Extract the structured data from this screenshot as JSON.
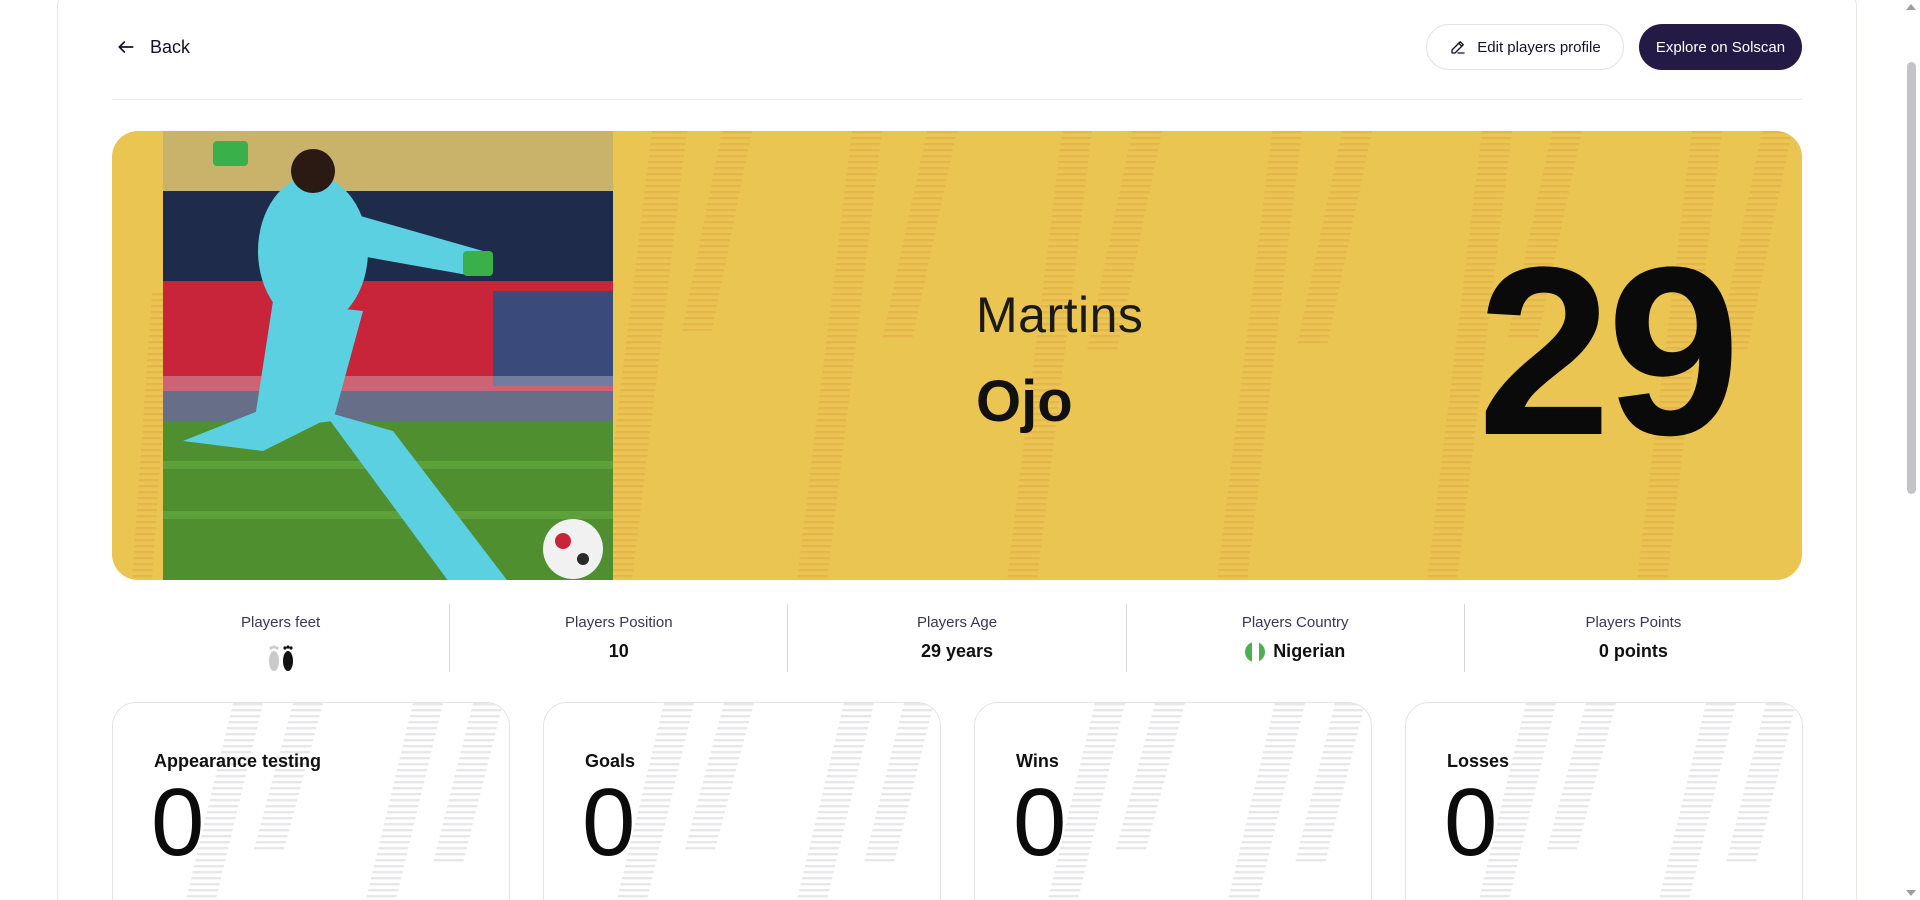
{
  "header": {
    "back_label": "Back",
    "edit_label": "Edit players profile",
    "explore_label": "Explore on Solscan"
  },
  "player": {
    "first_name": "Martins",
    "last_name": "Ojo",
    "number": "29"
  },
  "info": [
    {
      "label": "Players feet",
      "value": ""
    },
    {
      "label": "Players Position",
      "value": "10"
    },
    {
      "label": "Players Age",
      "value": "29 years"
    },
    {
      "label": "Players Country",
      "value": "Nigerian"
    },
    {
      "label": "Players Points",
      "value": "0 points"
    }
  ],
  "stats": [
    {
      "label": "Appearance testing",
      "value": "0"
    },
    {
      "label": "Goals",
      "value": "0"
    },
    {
      "label": "Wins",
      "value": "0"
    },
    {
      "label": "Losses",
      "value": "0"
    }
  ],
  "colors": {
    "hero_bg": "#ebc552",
    "primary_button": "#231a45",
    "flag_green": "#4caf50"
  },
  "icons": {
    "back": "arrow-left-icon",
    "edit": "pencil-icon",
    "feet": "feet-icon",
    "flag": "nigeria-flag-icon"
  }
}
